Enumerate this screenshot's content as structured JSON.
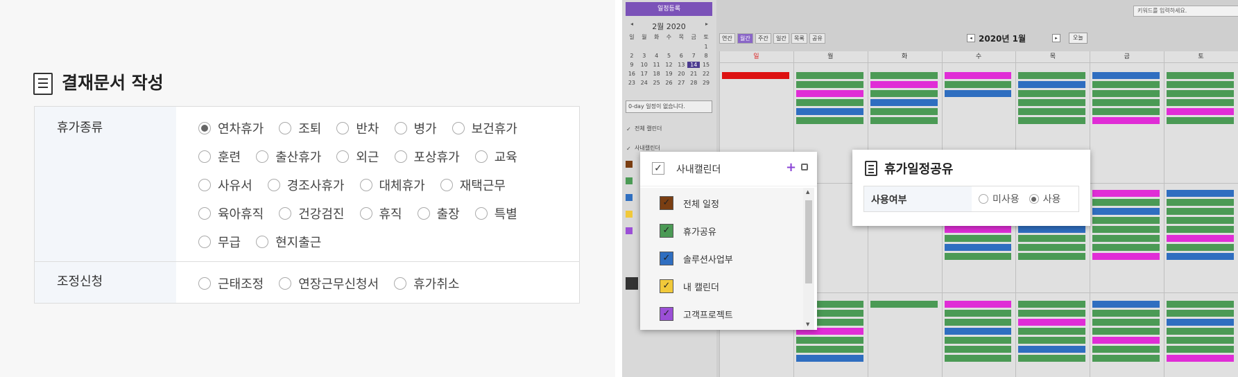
{
  "left": {
    "title": "결재문서 작성",
    "rows": [
      {
        "label": "휴가종류",
        "options": [
          "연차휴가",
          "조퇴",
          "반차",
          "병가",
          "보건휴가",
          "훈련",
          "출산휴가",
          "외근",
          "포상휴가",
          "교육",
          "사유서",
          "경조사휴가",
          "대체휴가",
          "재택근무",
          "육아휴직",
          "건강검진",
          "휴직",
          "출장",
          "특별",
          "무급",
          "현지출근"
        ],
        "selected": "연차휴가"
      },
      {
        "label": "조정신청",
        "options": [
          "근태조정",
          "연장근무신청서",
          "휴가취소"
        ],
        "selected": ""
      }
    ]
  },
  "right": {
    "register_button": "일정등록",
    "mini_cal": {
      "title": "2월 2020",
      "weekdays": [
        "일",
        "월",
        "화",
        "수",
        "목",
        "금",
        "토"
      ],
      "days": [
        "",
        "",
        "",
        "",
        "",
        "",
        "1",
        "2",
        "3",
        "4",
        "5",
        "6",
        "7",
        "8",
        "9",
        "10",
        "11",
        "12",
        "13",
        "14",
        "15",
        "16",
        "17",
        "18",
        "19",
        "20",
        "21",
        "22",
        "23",
        "24",
        "25",
        "26",
        "27",
        "28",
        "29"
      ],
      "selected_day": "14"
    },
    "empty_select": "0-day 일정이 없습니다.",
    "all_calendars": "전체 캘린더",
    "company_calendar": "사내캘린더",
    "search_placeholder": "키워드를 입력하세요.",
    "view_tabs": [
      "연간",
      "월간",
      "주간",
      "일간",
      "목록",
      "공유"
    ],
    "active_view": "월간",
    "cal_title": "2020년 1월",
    "today": "오늘",
    "weekdays": [
      "일",
      "월",
      "화",
      "수",
      "목",
      "금",
      "토"
    ],
    "popup_calendars": {
      "title": "사내캘린더",
      "items": [
        {
          "label": "전체 일정",
          "color": "#7a3e12"
        },
        {
          "label": "휴가공유",
          "color": "#4b9a55"
        },
        {
          "label": "솔루션사업부",
          "color": "#2f6ec0"
        },
        {
          "label": "내 캘린더",
          "color": "#f1c93a"
        },
        {
          "label": "고객프로젝트",
          "color": "#9b4fd6"
        }
      ]
    },
    "popup_share": {
      "title": "휴가일정공유",
      "label": "사용여부",
      "options": [
        "미사용",
        "사용"
      ],
      "selected": "사용"
    }
  }
}
